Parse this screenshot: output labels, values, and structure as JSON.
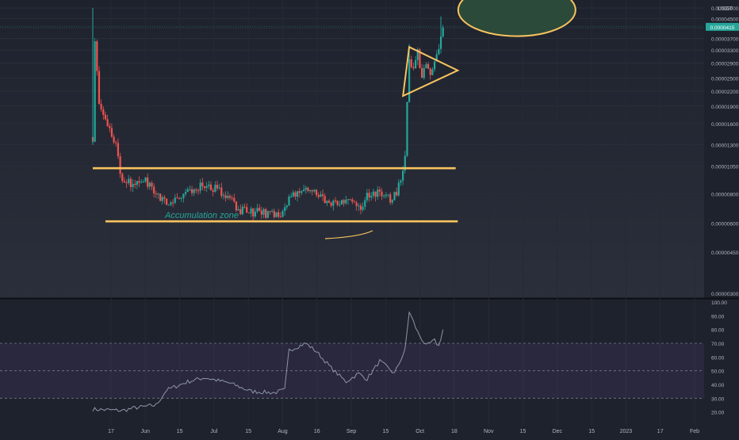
{
  "colors": {
    "background_top": "#20242f",
    "background_bottom": "#2a2e39",
    "up": "#26a69a",
    "down": "#ef5350",
    "annotation": "#f7c35f",
    "ellipse_fill": "#2c4a3a",
    "rsi_line": "#8e95a6",
    "rsi_band": "#7e57c2",
    "axis_text": "#b2b5be",
    "price_tag": "#26a69a"
  },
  "price_axis": {
    "currency": "USDT",
    "ticks": [
      "0.00005000",
      "0.00004500",
      "0.00004100",
      "0.00003700",
      "0.00003300",
      "0.00002900",
      "0.00002500",
      "0.00002200",
      "0.00001900",
      "0.00001600",
      "0.00001300",
      "0.00001050",
      "0.00000800",
      "0.00000600",
      "0.00000450",
      "0.00000300"
    ],
    "last_price_label": "0.0000415"
  },
  "rsi_axis": {
    "ticks": [
      "100.00",
      "90.00",
      "80.00",
      "70.00",
      "60.00",
      "50.00",
      "40.00",
      "30.00",
      "20.00"
    ]
  },
  "time_axis": {
    "labels": [
      "17",
      "Jun",
      "15",
      "Jul",
      "15",
      "Aug",
      "16",
      "Sep",
      "15",
      "Oct",
      "18",
      "Nov",
      "15",
      "Dec",
      "15",
      "2023",
      "17",
      "Feb"
    ]
  },
  "annotations": {
    "accumulation_label": "Accumulation zone"
  },
  "chart_data": [
    {
      "type": "candlestick",
      "scale": "log",
      "y_unit": "USDT",
      "ylim": [
        3e-06,
        5e-05
      ],
      "x_range": [
        "2022-05-11",
        "2023-02-24"
      ],
      "price_path": [
        {
          "date": "2022-05-11",
          "price": 1.4e-05
        },
        {
          "date": "2022-05-12",
          "price": 3.5e-05
        },
        {
          "date": "2022-05-14",
          "price": 2e-05
        },
        {
          "date": "2022-05-17",
          "price": 1.6e-05
        },
        {
          "date": "2022-05-22",
          "price": 1.3e-05
        },
        {
          "date": "2022-05-25",
          "price": 9e-06
        },
        {
          "date": "2022-05-30",
          "price": 8.8e-06
        },
        {
          "date": "2022-06-05",
          "price": 9.2e-06
        },
        {
          "date": "2022-06-10",
          "price": 7.8e-06
        },
        {
          "date": "2022-06-15",
          "price": 7.2e-06
        },
        {
          "date": "2022-06-25",
          "price": 8.2e-06
        },
        {
          "date": "2022-07-01",
          "price": 8.7e-06
        },
        {
          "date": "2022-07-10",
          "price": 8.3e-06
        },
        {
          "date": "2022-07-20",
          "price": 6.8e-06
        },
        {
          "date": "2022-08-01",
          "price": 6.6e-06
        },
        {
          "date": "2022-08-08",
          "price": 6.5e-06
        },
        {
          "date": "2022-08-14",
          "price": 8e-06
        },
        {
          "date": "2022-08-20",
          "price": 8.5e-06
        },
        {
          "date": "2022-09-01",
          "price": 7.2e-06
        },
        {
          "date": "2022-09-10",
          "price": 7.8e-06
        },
        {
          "date": "2022-09-15",
          "price": 7.1e-06
        },
        {
          "date": "2022-09-20",
          "price": 8.2e-06
        },
        {
          "date": "2022-09-30",
          "price": 7.5e-06
        },
        {
          "date": "2022-10-04",
          "price": 9e-06
        },
        {
          "date": "2022-10-06",
          "price": 1.15e-05
        },
        {
          "date": "2022-10-07",
          "price": 1.9e-05
        },
        {
          "date": "2022-10-08",
          "price": 3e-05
        },
        {
          "date": "2022-10-10",
          "price": 2.7e-05
        },
        {
          "date": "2022-10-12",
          "price": 3.2e-05
        },
        {
          "date": "2022-10-14",
          "price": 2.6e-05
        },
        {
          "date": "2022-10-16",
          "price": 2.9e-05
        },
        {
          "date": "2022-10-18",
          "price": 2.7e-05
        },
        {
          "date": "2022-10-20",
          "price": 3e-05
        },
        {
          "date": "2022-10-22",
          "price": 3.3e-05
        },
        {
          "date": "2022-10-23",
          "price": 3.7e-05
        },
        {
          "date": "2022-10-24",
          "price": 4.15e-05
        }
      ],
      "spikes": [
        {
          "date": "2022-05-11",
          "high": 5e-05,
          "low": 1.3e-05
        },
        {
          "date": "2022-10-08",
          "high": 3.5e-05,
          "low": 2.2e-05
        },
        {
          "date": "2022-10-23",
          "high": 4.6e-05,
          "low": 3.4e-05
        }
      ],
      "last_price": 4.15e-05,
      "annotations": [
        {
          "kind": "horizontal-line",
          "price": 1.03e-05,
          "from": "2022-05-11",
          "to": "2022-10-30"
        },
        {
          "kind": "horizontal-line",
          "price": 6.1e-06,
          "from": "2022-05-17",
          "to": "2022-10-31"
        },
        {
          "kind": "triangle",
          "points": [
            [
              "2022-10-08",
              3.4e-05
            ],
            [
              "2022-10-31",
              2.7e-05
            ],
            [
              "2022-10-05",
              2.1e-05
            ]
          ]
        },
        {
          "kind": "ellipse",
          "center": [
            "2022-11-28",
            4.9e-05
          ]
        }
      ]
    },
    {
      "type": "line",
      "indicator": "RSI",
      "ylim": [
        10,
        100
      ],
      "band": [
        30,
        70
      ],
      "midline": 50,
      "points": [
        {
          "date": "2022-05-11",
          "value": 22
        },
        {
          "date": "2022-05-25",
          "value": 21
        },
        {
          "date": "2022-05-31",
          "value": 23
        },
        {
          "date": "2022-06-10",
          "value": 25
        },
        {
          "date": "2022-06-15",
          "value": 36
        },
        {
          "date": "2022-06-25",
          "value": 42
        },
        {
          "date": "2022-07-03",
          "value": 45
        },
        {
          "date": "2022-07-15",
          "value": 41
        },
        {
          "date": "2022-07-25",
          "value": 35
        },
        {
          "date": "2022-08-05",
          "value": 34
        },
        {
          "date": "2022-08-10",
          "value": 36
        },
        {
          "date": "2022-08-12",
          "value": 65
        },
        {
          "date": "2022-08-20",
          "value": 70
        },
        {
          "date": "2022-08-25",
          "value": 64
        },
        {
          "date": "2022-09-01",
          "value": 52
        },
        {
          "date": "2022-09-08",
          "value": 42
        },
        {
          "date": "2022-09-14",
          "value": 48
        },
        {
          "date": "2022-09-18",
          "value": 44
        },
        {
          "date": "2022-09-24",
          "value": 57
        },
        {
          "date": "2022-10-01",
          "value": 48
        },
        {
          "date": "2022-10-06",
          "value": 65
        },
        {
          "date": "2022-10-08",
          "value": 93
        },
        {
          "date": "2022-10-12",
          "value": 78
        },
        {
          "date": "2022-10-16",
          "value": 68
        },
        {
          "date": "2022-10-20",
          "value": 72
        },
        {
          "date": "2022-10-22",
          "value": 68
        },
        {
          "date": "2022-10-24",
          "value": 80
        }
      ]
    }
  ]
}
